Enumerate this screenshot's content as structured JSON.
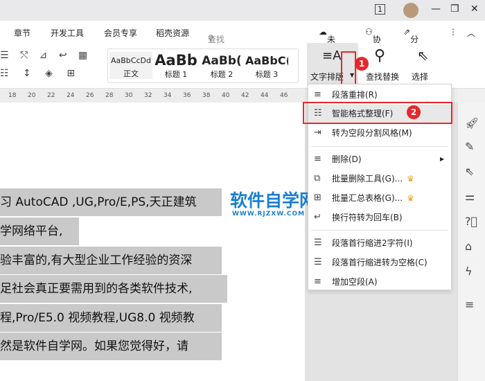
{
  "titlebar": {
    "window_count": "1",
    "minimize": "—",
    "restore": "❐",
    "close": "✕"
  },
  "tabs": [
    {
      "label": "章节"
    },
    {
      "label": "开发工具"
    },
    {
      "label": "会员专享"
    },
    {
      "label": "稻壳资源"
    }
  ],
  "search": {
    "placeholder": "查找命令、搜索模板"
  },
  "actions": {
    "unsaved": "未保存",
    "collab": "协作",
    "share": "分享"
  },
  "styles": [
    {
      "sample": "AaBbCcDd",
      "name": "正文"
    },
    {
      "sample": "AaBb",
      "name": "标题 1"
    },
    {
      "sample": "AaBb(",
      "name": "标题 2"
    },
    {
      "sample": "AaBbC(",
      "name": "标题 3"
    }
  ],
  "toolbar": {
    "text_layout": "文字排版",
    "find_replace": "查找替换",
    "select": "选择"
  },
  "ruler": [
    "18",
    "20",
    "22",
    "24",
    "26",
    "28",
    "30",
    "32",
    "34",
    "36",
    "38",
    "40",
    "42",
    "44",
    "46"
  ],
  "document": {
    "lines": [
      "习 AutoCAD ,UG,Pro/E,PS,天正建筑",
      "学网络平台,",
      "验丰富的,有大型企业工作经验的资深",
      "足社会真正要需用到的各类软件技术,",
      "程,Pro/E5.0 视频教程,UG8.0 视频教",
      "然是软件自学网。如果您觉得好，请"
    ]
  },
  "watermark": {
    "title": "软件自学网",
    "url": "WWW.RJZXW.COM"
  },
  "menu": {
    "items": [
      {
        "label": "段落重排(R)"
      },
      {
        "label": "智能格式整理(F)"
      },
      {
        "label": "转为空段分割风格(M)"
      },
      {
        "label": "删除(D)"
      },
      {
        "label": "批量删除工具(G)..."
      },
      {
        "label": "批量汇总表格(G)..."
      },
      {
        "label": "换行符转为回车(B)"
      },
      {
        "label": "段落首行缩进2字符(I)"
      },
      {
        "label": "段落首行缩进转为空格(C)"
      },
      {
        "label": "增加空段(A)"
      }
    ]
  },
  "badges": {
    "one": "1",
    "two": "2"
  },
  "colors": {
    "accent": "#e8262b",
    "watermark": "#1a7fd1",
    "selection": "#c9c9c9"
  }
}
